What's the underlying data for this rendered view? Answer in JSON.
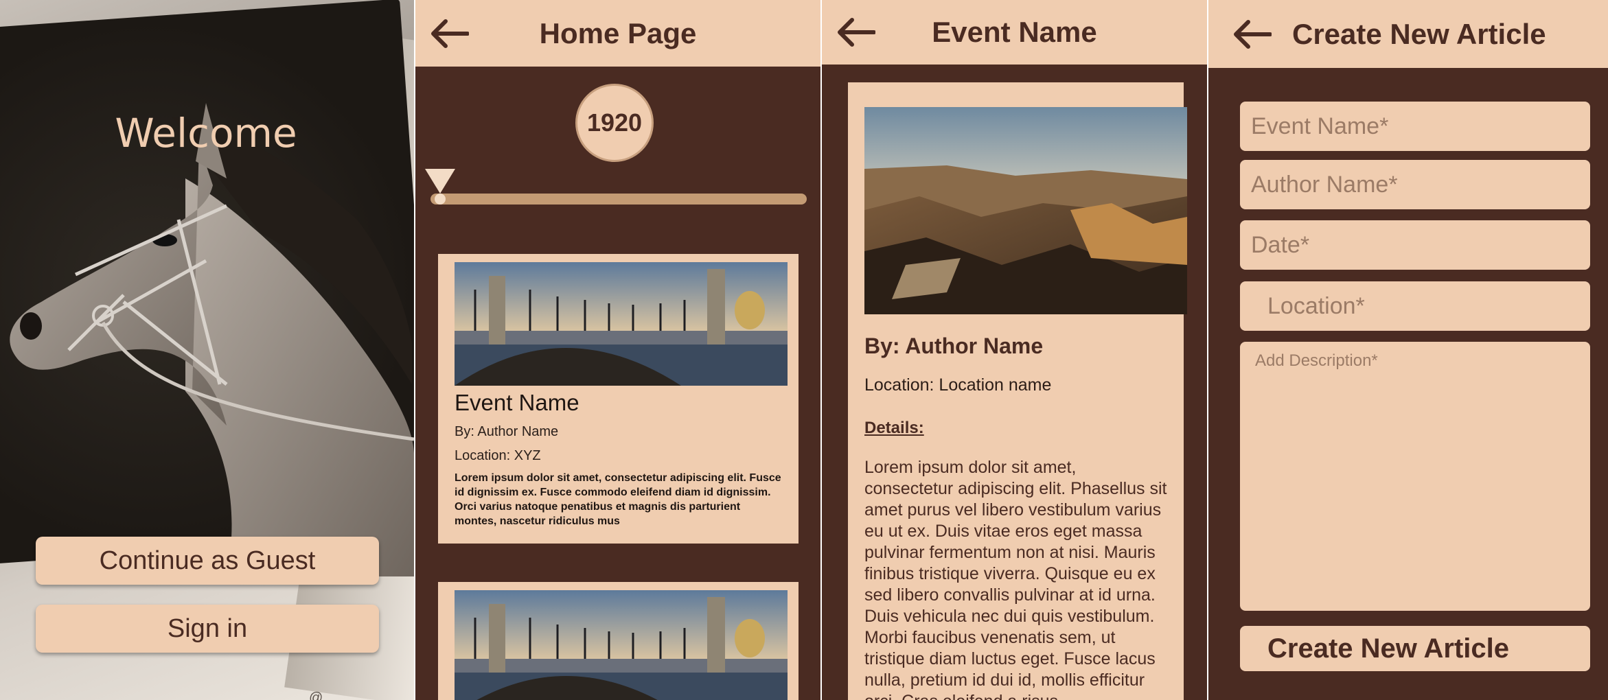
{
  "welcome_screen": {
    "title": "Welcome",
    "guest_button": "Continue as Guest",
    "signin_button": "Sign in",
    "watermark": "@"
  },
  "home_screen": {
    "title": "Home Page",
    "year": "1920",
    "cards": [
      {
        "event_name": "Event Name",
        "author": "By: Author Name",
        "location": "Location: XYZ",
        "text": "Lorem ipsum dolor sit amet, consectetur adipiscing elit. Fusce id dignissim ex. Fusce commodo eleifend diam id dignissim. Orci varius natoque penatibus et magnis dis parturient montes, nascetur ridiculus mus"
      },
      {
        "event_name": "",
        "author": "",
        "location": "",
        "text": ""
      }
    ]
  },
  "event_screen": {
    "title": "Event Name",
    "author": "By: Author Name",
    "location": "Location: Location name",
    "details_label": "Details:",
    "details": "Lorem ipsum dolor sit amet, consectetur adipiscing elit. Phasellus sit amet purus vel libero vestibulum varius eu ut ex. Duis vitae eros eget massa pulvinar fermentum non at nisi. Mauris finibus tristique viverra. Quisque eu ex sed libero convallis pulvinar at id urna. Duis vehicula nec dui quis vestibulum. Morbi faucibus venenatis sem, ut tristique diam luctus eget. Fusce lacus nulla, pretium id dui id, mollis efficitur orci. Cras eleifend a risus"
  },
  "create_screen": {
    "title": "Create New Article",
    "event_name_placeholder": "Event Name*",
    "author_placeholder": "Author Name*",
    "date_placeholder": "Date*",
    "location_placeholder": "Location*",
    "description_placeholder": "Add Description*",
    "submit_button": "Create New Article"
  },
  "colors": {
    "primary_dark": "#4a2b22",
    "primary_light": "#f0cdb0",
    "slider": "#c49b74",
    "placeholder": "#9b7b66"
  },
  "icons": [
    "back-arrow-icon",
    "slider-thumb-icon"
  ]
}
